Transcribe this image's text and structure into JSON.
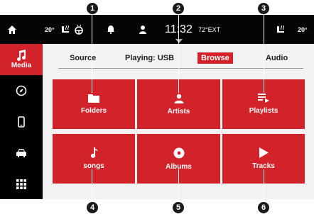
{
  "callouts": [
    "1",
    "2",
    "3",
    "4",
    "5",
    "6"
  ],
  "status_bar": {
    "left_temp": "20°",
    "time": "11:32",
    "outside_temp": "72°EXT",
    "right_temp": "20°"
  },
  "sidebar": {
    "items": [
      {
        "icon": "music-note-icon",
        "label": "Media",
        "active": true
      },
      {
        "icon": "compass-icon",
        "label": ""
      },
      {
        "icon": "phone-icon",
        "label": ""
      },
      {
        "icon": "car-icon",
        "label": ""
      },
      {
        "icon": "apps-grid-icon",
        "label": ""
      }
    ]
  },
  "tabs": {
    "source": "Source",
    "playing": "Playing: USB",
    "browse": "Browse",
    "audio": "Audio"
  },
  "tiles": [
    {
      "icon": "folder-icon",
      "label": "Folders"
    },
    {
      "icon": "artist-icon",
      "label": "Artists"
    },
    {
      "icon": "playlist-icon",
      "label": "Playlists"
    },
    {
      "icon": "song-icon",
      "label": "songs"
    },
    {
      "icon": "album-icon",
      "label": "Albums"
    },
    {
      "icon": "play-icon",
      "label": "Tracks"
    }
  ],
  "colors": {
    "accent": "#d2232a",
    "bar": "#050505",
    "panel": "#f2f2f2"
  }
}
